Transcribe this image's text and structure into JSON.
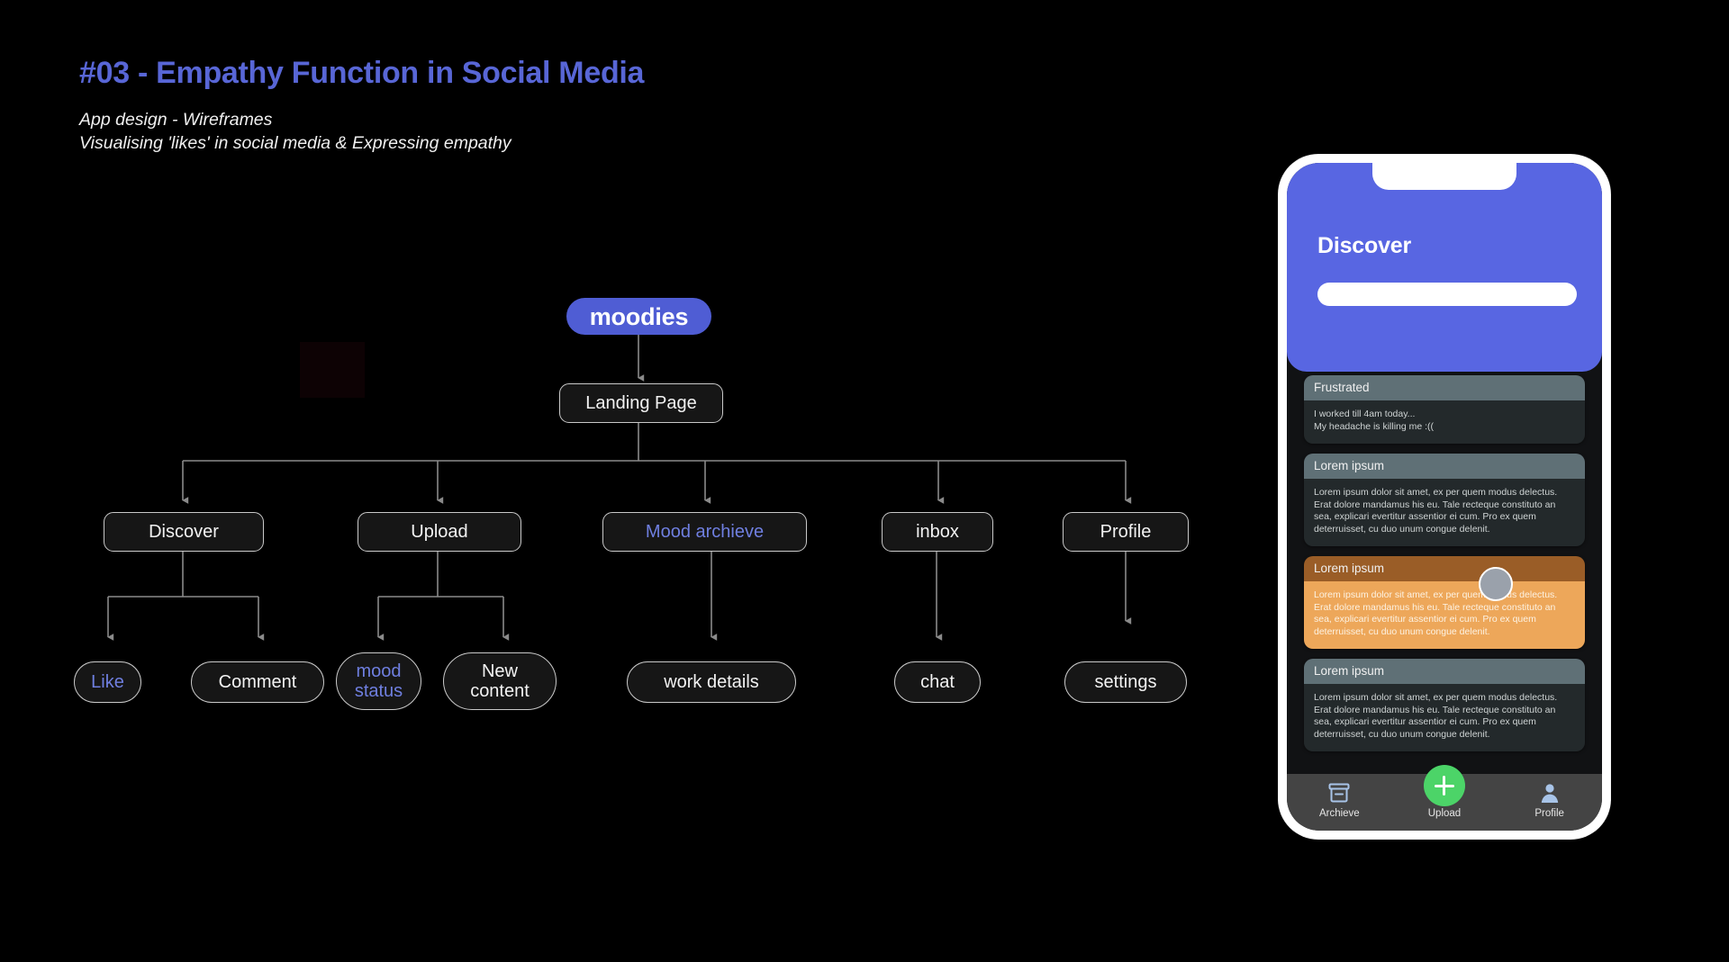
{
  "header": {
    "title": "#03 - Empathy Function in Social Media",
    "subtitle_line_1": "App design - Wireframes",
    "subtitle_line_2": "Visualising 'likes' in social media & Expressing empathy",
    "accent_color": "#5866d6"
  },
  "flowchart": {
    "root": {
      "label": "moodies",
      "color": "#4f5dd4"
    },
    "landing": {
      "label": "Landing Page"
    },
    "level2": [
      {
        "label": "Discover",
        "highlight": false
      },
      {
        "label": "Upload",
        "highlight": false
      },
      {
        "label": "Mood archieve",
        "highlight": true
      },
      {
        "label": "inbox",
        "highlight": false
      },
      {
        "label": "Profile",
        "highlight": false
      }
    ],
    "level3": [
      {
        "label": "Like",
        "highlight": true
      },
      {
        "label": "Comment",
        "highlight": false
      },
      {
        "label": "mood\nstatus",
        "highlight": true
      },
      {
        "label": "New\ncontent",
        "highlight": false
      },
      {
        "label": "work details",
        "highlight": false
      },
      {
        "label": "chat",
        "highlight": false
      },
      {
        "label": "settings",
        "highlight": false
      }
    ],
    "highlight_color": "#6f7fe0",
    "line_color": "#8a8a8a"
  },
  "phone": {
    "screen_title": "Discover",
    "header_color": "#5866e2",
    "search_placeholder": "",
    "cards": [
      {
        "title": "Frustrated",
        "body": "I worked till 4am today...\nMy headache is killing me :((",
        "theme": "teal"
      },
      {
        "title": "Lorem ipsum",
        "body": "Lorem ipsum dolor sit amet, ex per quem modus delectus. Erat dolore mandamus his eu. Tale recteque constituto an sea, explicari evertitur assentior ei cum. Pro ex quem deterruisset, cu duo unum congue delenit.",
        "theme": "teal"
      },
      {
        "title": "Lorem ipsum",
        "body": "Lorem ipsum dolor sit amet, ex per quem modus delectus. Erat dolore mandamus his eu. Tale recteque constituto an sea, explicari evertitur assentior ei cum. Pro ex quem deterruisset, cu duo unum congue delenit.",
        "theme": "orange"
      },
      {
        "title": "Lorem ipsum",
        "body": "Lorem ipsum dolor sit amet, ex per quem modus delectus. Erat dolore mandamus his eu. Tale recteque constituto an sea, explicari evertitur assentior ei cum. Pro ex quem deterruisset, cu duo unum congue delenit.",
        "theme": "teal"
      }
    ],
    "bottom_nav": [
      {
        "label": "Archieve",
        "icon": "archive-box-icon"
      },
      {
        "label": "Upload",
        "icon": "plus-icon"
      },
      {
        "label": "Profile",
        "icon": "person-icon"
      }
    ],
    "fab_color": "#4cd468",
    "nav_icon_color": "#a8c4e8"
  }
}
